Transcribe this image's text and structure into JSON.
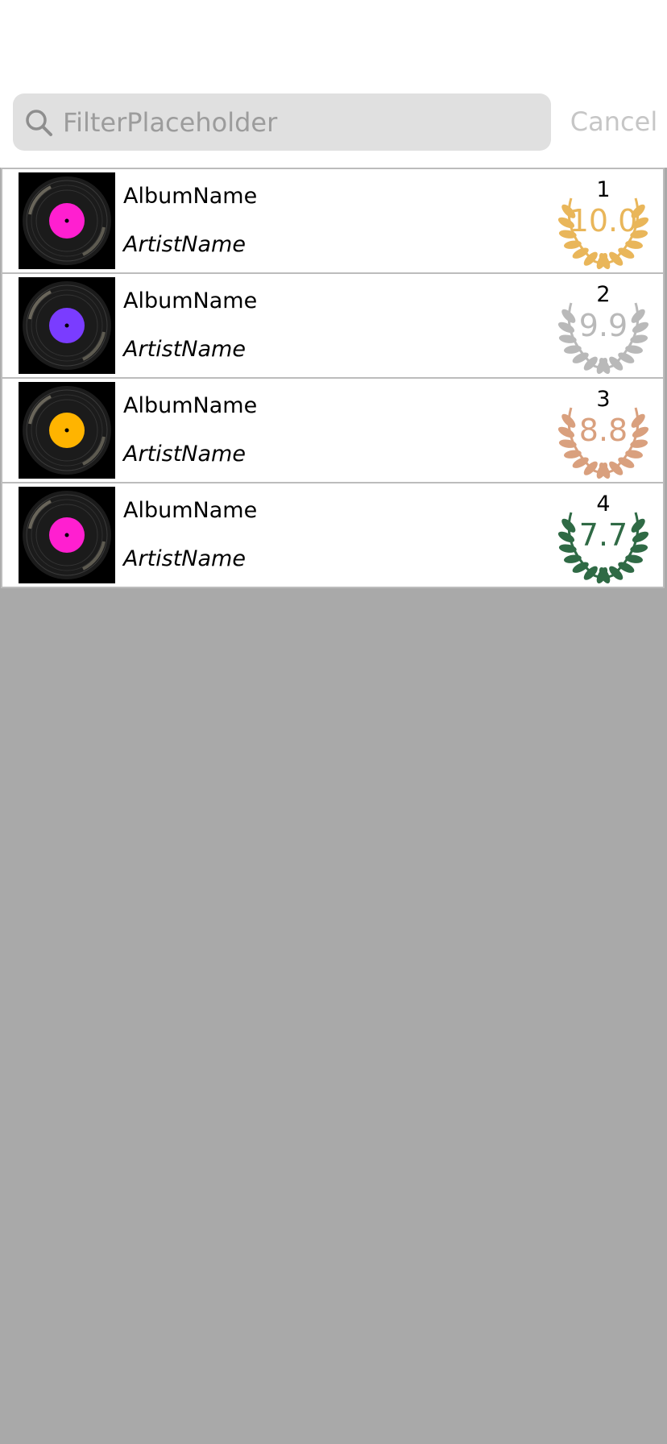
{
  "search": {
    "placeholder": "FilterPlaceholder",
    "value": "",
    "cancel_label": "Cancel"
  },
  "icons": {
    "search": "search-icon",
    "album_cover": "vinyl-record-icon",
    "laurel": "laurel-wreath-icon"
  },
  "colors": {
    "gold": "#e9b65a",
    "silver": "#b9b9b9",
    "bronze": "#d9a07e",
    "green": "#2f6a45",
    "background": "#a9a9a9",
    "search_bg": "#e0e0e0"
  },
  "rows": [
    {
      "album": "AlbumName",
      "artist": "ArtistName",
      "rank": "1",
      "score": "10.0",
      "badge_color": "#e9b65a",
      "label_color": "#ff1fd0"
    },
    {
      "album": "AlbumName",
      "artist": "ArtistName",
      "rank": "2",
      "score": "9.9",
      "badge_color": "#b9b9b9",
      "label_color": "#7a3cff"
    },
    {
      "album": "AlbumName",
      "artist": "ArtistName",
      "rank": "3",
      "score": "8.8",
      "badge_color": "#d9a07e",
      "label_color": "#ffb400"
    },
    {
      "album": "AlbumName",
      "artist": "ArtistName",
      "rank": "4",
      "score": "7.7",
      "badge_color": "#2f6a45",
      "label_color": "#ff1fd0"
    }
  ]
}
